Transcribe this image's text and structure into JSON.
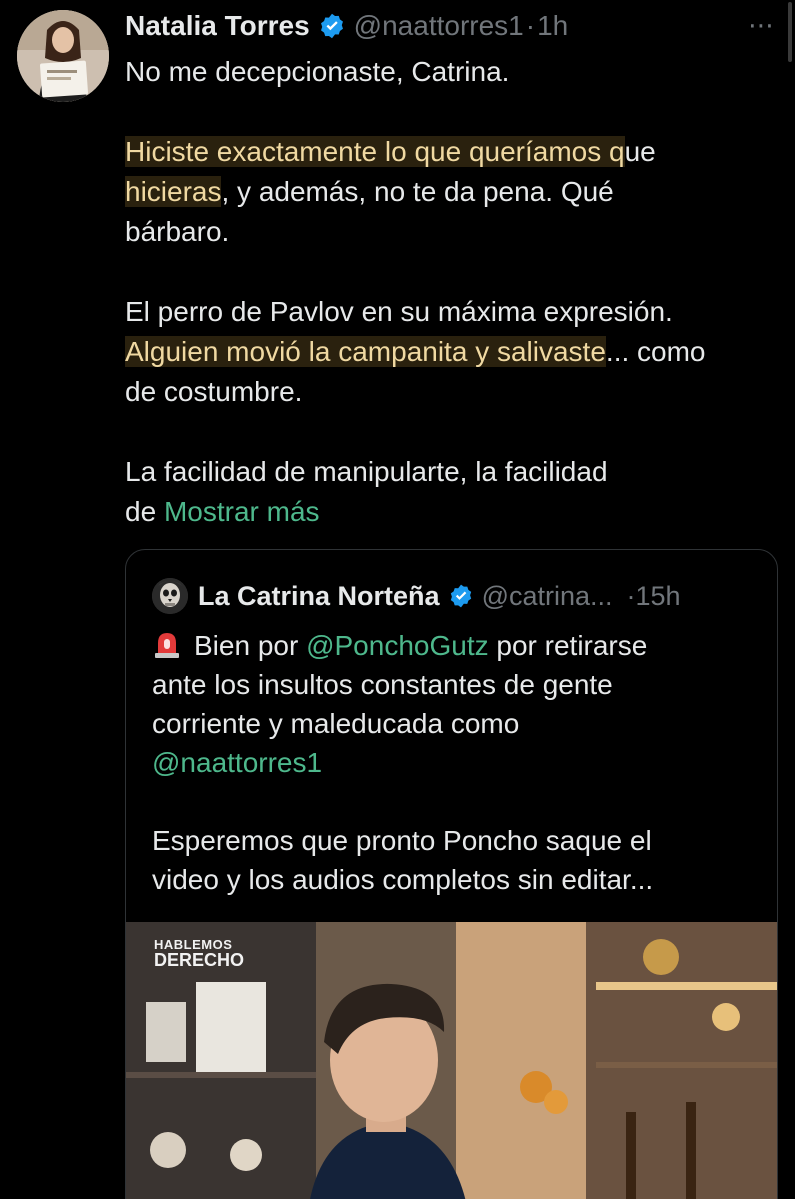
{
  "tweet": {
    "author": {
      "display_name": "Natalia Torres",
      "handle": "@naattorres1",
      "separator": "·",
      "time": "1h",
      "verified_icon": "verified-badge-icon"
    },
    "more_icon": "⋯",
    "text": {
      "line1": "No me decepcionaste, Catrina.",
      "p2_highlight": "Hiciste exactamente lo que queríamos q",
      "p2_rest": "ue",
      "p2_line2_hl": "hicieras",
      "p2_line2_rest": ", y además, no te da pena. Qué",
      "p2_line3": "bárbaro.",
      "p3_line1": "El perro de Pavlov en su máxima expresión.",
      "p3_line2_hl": "Alguien movió la campanita y salivaste",
      "p3_line2_rest": "... como",
      "p3_line3": "de costumbre.",
      "p4_line1": "La facilidad de manipularte, la facilidad",
      "p4_line2": "de ",
      "show_more": "Mostrar más"
    }
  },
  "quote": {
    "display_name": "La Catrina Norteña",
    "handle": "@catrina...",
    "time": "·15h",
    "text": {
      "l1_pre": "Bien por ",
      "l1_mention": "@PonchoGutz",
      "l1_post": " por retirarse",
      "l2": "ante los insultos constantes de gente",
      "l3": "corriente y maleducada como",
      "l4_mention": "@naattorres1",
      "l5": "Esperemos que pronto Poncho saque el",
      "l6": "video y los audios completos sin editar..."
    },
    "media": {
      "watermark_line1": "HABLEMOS",
      "watermark_line2": "DERECHO"
    }
  },
  "colors": {
    "background": "#000000",
    "text": "#e7e9ea",
    "secondary": "#71767b",
    "link": "#4eb88c",
    "verified": "#1d9bf0",
    "highlight_text": "#f0d9a2"
  }
}
